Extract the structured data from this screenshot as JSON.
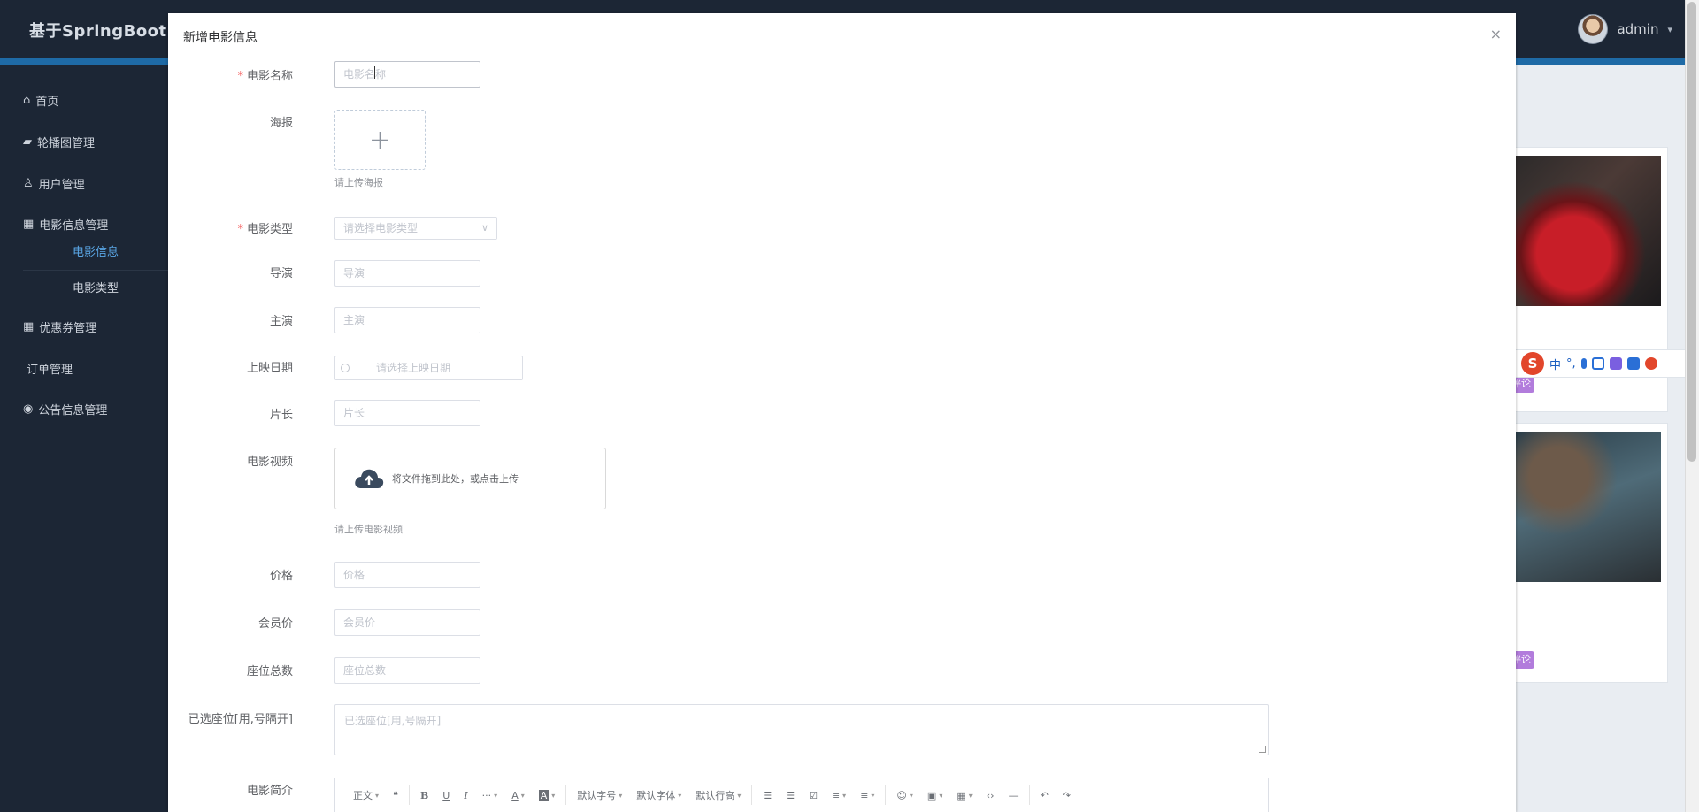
{
  "app": {
    "title": "基于SpringBoot+V",
    "user": "admin"
  },
  "sidebar": {
    "items": [
      {
        "label": "首页",
        "icon": "home-icon"
      },
      {
        "label": "轮播图管理",
        "icon": "image-icon"
      },
      {
        "label": "用户管理",
        "icon": "user-icon"
      },
      {
        "label": "电影信息管理",
        "icon": "film-icon"
      },
      {
        "label": "优惠券管理",
        "icon": "coupon-icon"
      },
      {
        "label": "订单管理",
        "icon": ""
      },
      {
        "label": "公告信息管理",
        "icon": "notice-icon"
      }
    ],
    "subitems": [
      {
        "label": "电影信息",
        "active": true
      },
      {
        "label": "电影类型",
        "active": false
      }
    ]
  },
  "background": {
    "tags": [
      "评论",
      "评论"
    ]
  },
  "ime": {
    "mode": "中",
    "punct": "°,"
  },
  "dialog": {
    "title": "新增电影信息",
    "close": "×",
    "fields": {
      "name": {
        "label": "电影名称",
        "placeholder": "电影名称"
      },
      "poster": {
        "label": "海报",
        "hint": "请上传海报",
        "plus": "+"
      },
      "type": {
        "label": "电影类型",
        "placeholder": "请选择电影类型"
      },
      "director": {
        "label": "导演",
        "placeholder": "导演"
      },
      "actors": {
        "label": "主演",
        "placeholder": "主演"
      },
      "release": {
        "label": "上映日期",
        "placeholder": "请选择上映日期"
      },
      "duration": {
        "label": "片长",
        "placeholder": "片长"
      },
      "video": {
        "label": "电影视频",
        "drop_text": "将文件拖到此处，或点击上传",
        "hint": "请上传电影视频"
      },
      "price": {
        "label": "价格",
        "placeholder": "价格"
      },
      "vip_price": {
        "label": "会员价",
        "placeholder": "会员价"
      },
      "seats": {
        "label": "座位总数",
        "placeholder": "座位总数"
      },
      "selected_seats": {
        "label": "已选座位[用,号隔开]",
        "placeholder": "已选座位[用,号隔开]"
      },
      "intro": {
        "label": "电影简介"
      }
    },
    "editor_toolbar": {
      "paragraph": "正文",
      "quote": "❝",
      "bold": "B",
      "underline": "U",
      "italic": "I",
      "more": "···",
      "font_color": "A",
      "bg_color": "A",
      "font_size": "默认字号",
      "font_family": "默认字体",
      "line_height": "默认行高",
      "bulleted": "☰",
      "numbered": "☰",
      "todo": "☑",
      "align": "≡",
      "indent": "≡",
      "emoji": "☺",
      "image": "▣",
      "table": "▦",
      "code": "‹›",
      "divider": "—",
      "undo": "↶",
      "redo": "↷"
    }
  }
}
